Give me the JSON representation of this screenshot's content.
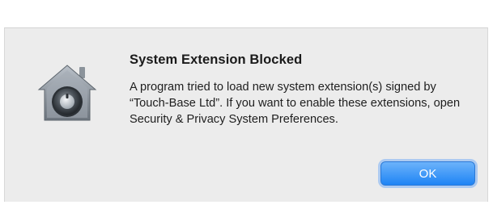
{
  "dialog": {
    "title": "System Extension Blocked",
    "message": "A program tried to load new system extension(s) signed by “Touch-Base Ltd”.  If you want to enable these extensions, open Security & Privacy System Preferences.",
    "icon": "security-house-lock-icon",
    "ok_label": "OK"
  },
  "colors": {
    "dialog_background": "#ececec",
    "button_accent": "#1e84f5"
  }
}
